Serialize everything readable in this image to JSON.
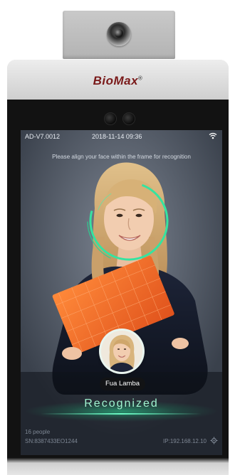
{
  "device": {
    "brand": "BioMax",
    "brand_mark": "®"
  },
  "status_bar": {
    "version": "AD-V7.0012",
    "datetime": "2018-11-14  09:36",
    "wifi_icon": "wifi-icon"
  },
  "screen": {
    "hint": "Please align your face within the frame for recognition",
    "recognized_name": "Fua Lamba",
    "result": "Recognized",
    "people_count": "16 people",
    "serial": "SN:8387433EO1244",
    "ip": "IP:192.168.12.10",
    "settings_icon": "gear-icon"
  },
  "colors": {
    "accent_green": "#3be6a0",
    "brand_red": "#7a1a1a",
    "folder_orange": "#f06a2a"
  }
}
